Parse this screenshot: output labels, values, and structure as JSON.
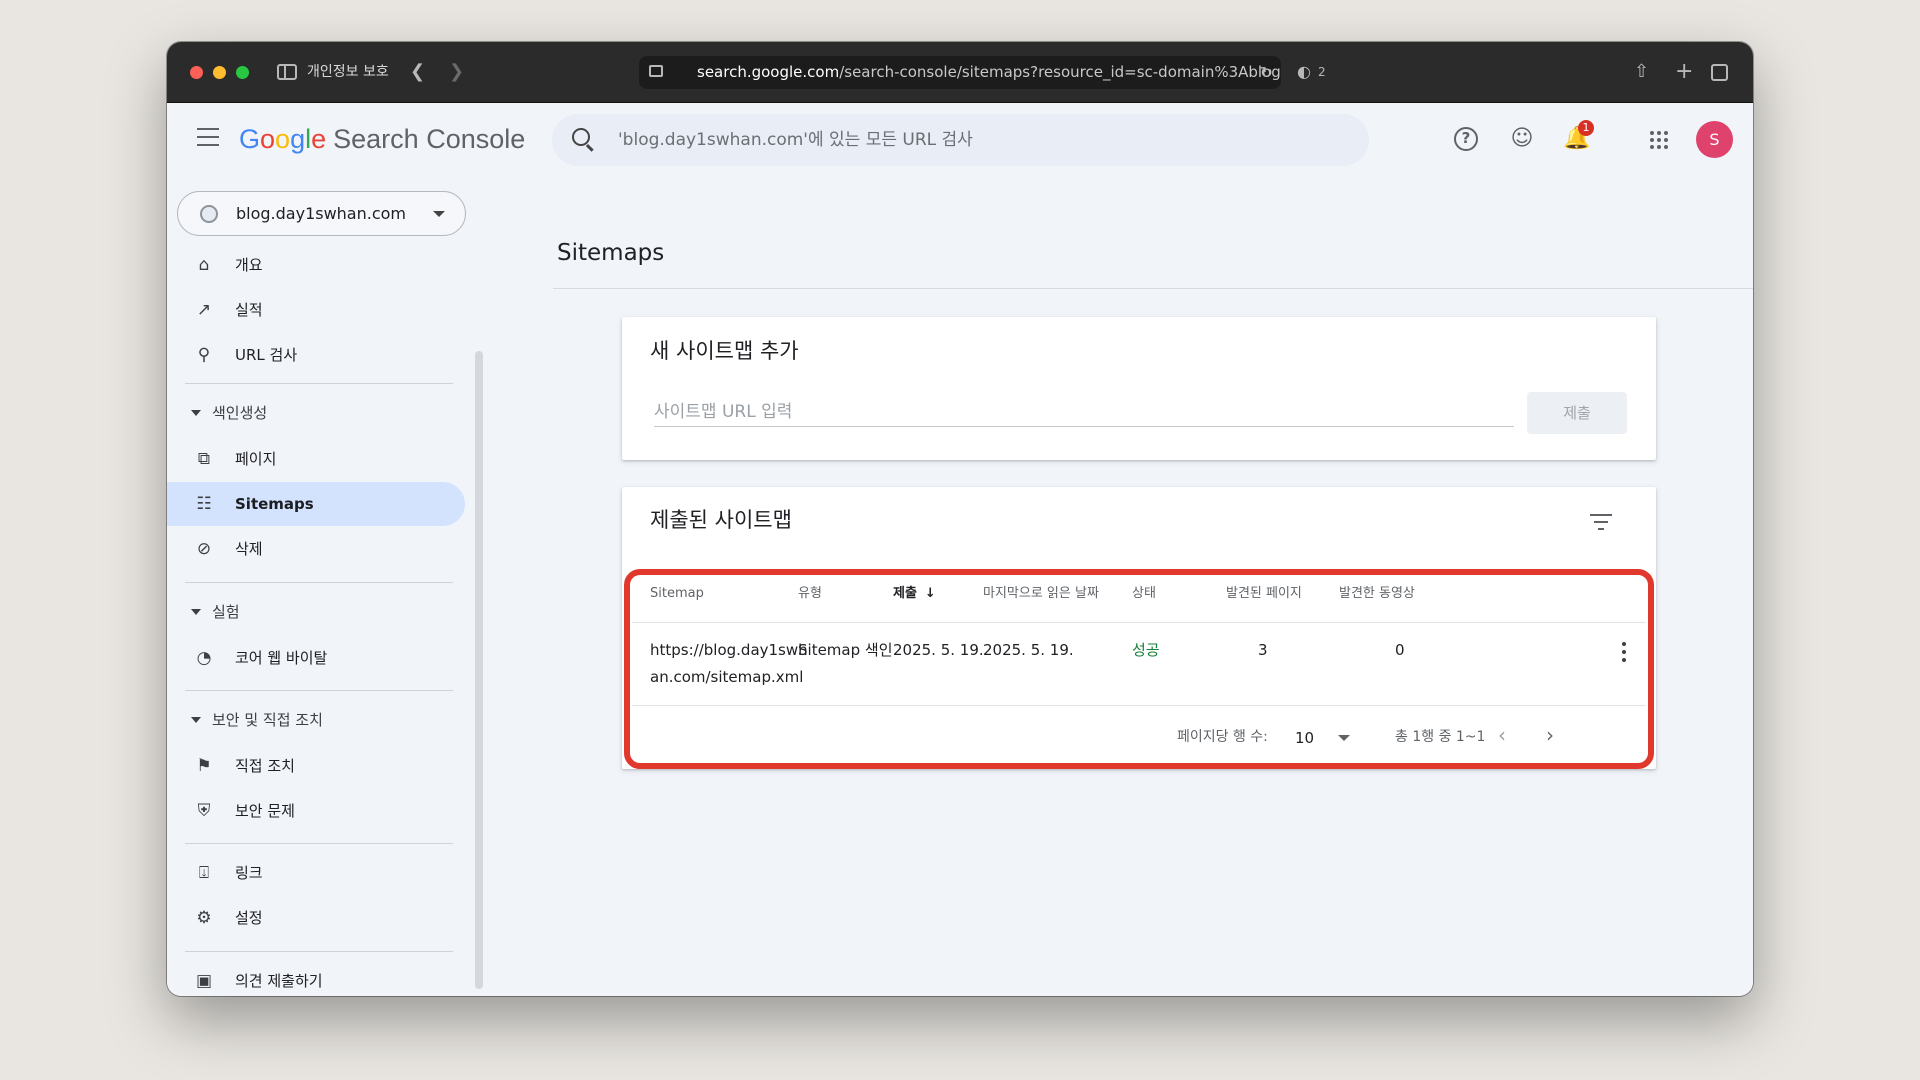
{
  "browser": {
    "privacy_label": "개인정보 보호",
    "url_host": "search.google.com",
    "url_path": "/search-console/sitemaps?resource_id=sc-domain%3Ablog",
    "shield_count": "2"
  },
  "app": {
    "logo_letters": [
      "G",
      "o",
      "o",
      "g",
      "l",
      "e"
    ],
    "product_name": "Search Console",
    "search_placeholder": "'blog.day1swhan.com'에 있는 모든 URL 검사",
    "notification_count": "1",
    "avatar_initial": "S"
  },
  "property": {
    "name": "blog.day1swhan.com"
  },
  "sidebar": {
    "overview": "개요",
    "performance": "실적",
    "url_inspection": "URL 검사",
    "indexing_section": "색인생성",
    "pages": "페이지",
    "sitemaps": "Sitemaps",
    "removals": "삭제",
    "experience_section": "실험",
    "core_web_vitals": "코어 웹 바이탈",
    "security_section": "보안 및 직접 조치",
    "manual_actions": "직접 조치",
    "security_issues": "보안 문제",
    "links": "링크",
    "settings": "설정",
    "feedback_partial": "의견 제출하기"
  },
  "main": {
    "page_title": "Sitemaps",
    "add_card": {
      "title": "새 사이트맵 추가",
      "input_placeholder": "사이트맵 URL 입력",
      "submit_label": "제출"
    },
    "list_card": {
      "title": "제출된 사이트맵",
      "columns": {
        "sitemap": "Sitemap",
        "type": "유형",
        "submitted": "제출",
        "last_read": "마지막으로 읽은 날짜",
        "status": "상태",
        "discovered_pages": "발견된 페이지",
        "discovered_videos": "발견한 동영상"
      },
      "rows": [
        {
          "sitemap_line1": "https://blog.day1swh",
          "sitemap_line2": "an.com/sitemap.xml",
          "type": "Sitemap 색인",
          "submitted": "2025. 5. 19.",
          "last_read": "2025. 5. 19.",
          "status": "성공",
          "discovered_pages": "3",
          "discovered_videos": "0"
        }
      ],
      "pagination": {
        "rows_per_page_label": "페이지당 행 수:",
        "rows_per_page_value": "10",
        "range": "총 1행 중 1~1"
      }
    }
  },
  "colors": {
    "highlight": "#e0382d",
    "status_success": "#188038",
    "active_nav": "#d3e3fd",
    "avatar": "#e0426e"
  }
}
